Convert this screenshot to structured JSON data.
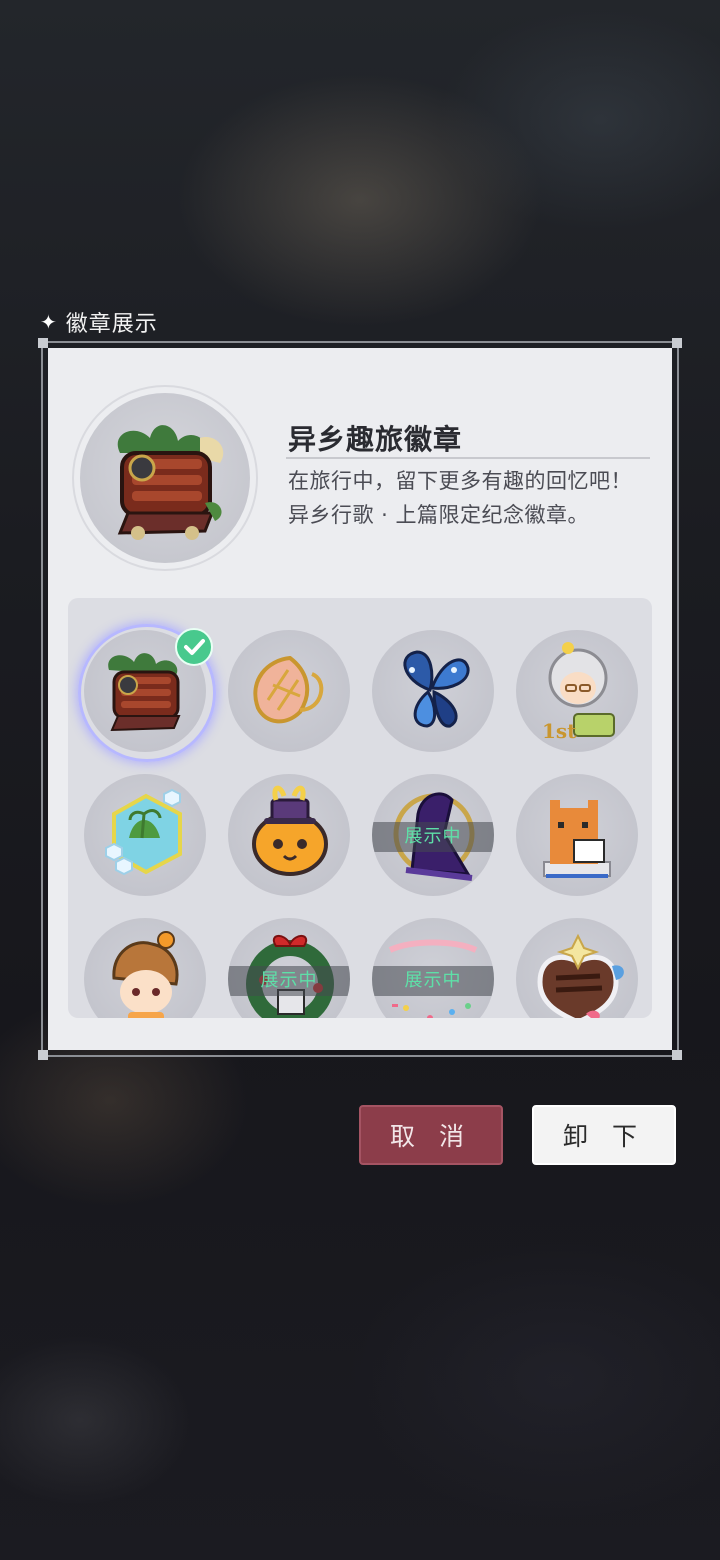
{
  "section": {
    "title": "徽章展示"
  },
  "featured_badge": {
    "name": "异乡趣旅徽章",
    "description": "在旅行中，留下更多有趣的回忆吧！异乡行歌 · 上篇限定纪念徽章。"
  },
  "grid": {
    "showing_label": "展示中",
    "badges": [
      {
        "id": "train",
        "selected": true,
        "showing": false
      },
      {
        "id": "leaf",
        "selected": false,
        "showing": false
      },
      {
        "id": "blue-butterfly",
        "selected": false,
        "showing": false
      },
      {
        "id": "chibi-1st",
        "selected": false,
        "showing": false
      },
      {
        "id": "island-cube",
        "selected": false,
        "showing": false
      },
      {
        "id": "orange-bunny",
        "selected": false,
        "showing": false
      },
      {
        "id": "purple-hat",
        "selected": false,
        "showing": true
      },
      {
        "id": "pixel-cat",
        "selected": false,
        "showing": false
      },
      {
        "id": "chibi-boy",
        "selected": false,
        "showing": false
      },
      {
        "id": "christmas-wreath",
        "selected": false,
        "showing": true
      },
      {
        "id": "2021",
        "selected": false,
        "showing": true
      },
      {
        "id": "chocolate-cake",
        "selected": false,
        "showing": false
      }
    ]
  },
  "buttons": {
    "cancel": "取 消",
    "remove": "卸 下"
  },
  "colors": {
    "accent_green": "#5ee0a8",
    "cancel_red": "#8c3d4a",
    "check_green": "#48c98d"
  }
}
